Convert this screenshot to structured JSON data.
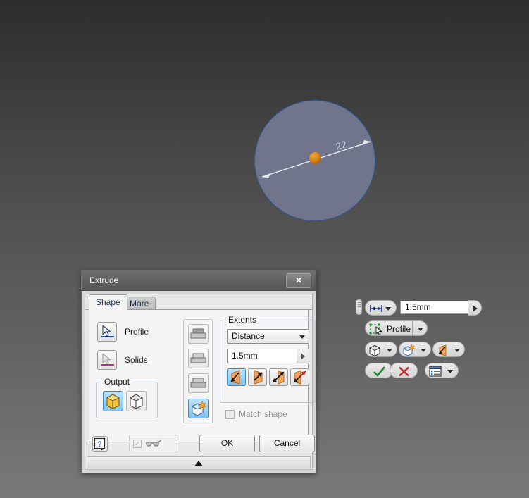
{
  "app": {
    "background_top": "#2d2d2e",
    "background_bottom": "#79797b"
  },
  "viewport": {
    "sketch": {
      "shape": "circle",
      "fill_color": "#70758c",
      "edge_color": "#2c5a96",
      "center_point_color": "#d9831c",
      "dimension_label": "22",
      "dimension_type": "diameter"
    }
  },
  "dialog": {
    "title": "Extrude",
    "close_label": "✕",
    "tabs": [
      {
        "label": "Shape",
        "active": true
      },
      {
        "label": "More",
        "active": false
      }
    ],
    "selectors": [
      {
        "label": "Profile",
        "icon": "arrow-cursor-icon",
        "underline_color": "#1b48c4",
        "active": true
      },
      {
        "label": "Solids",
        "icon": "arrow-cursor-icon",
        "underline_color": "#c42b86",
        "active": false
      }
    ],
    "output": {
      "caption": "Output",
      "options": [
        {
          "name": "solid",
          "icon": "solid-cube-icon",
          "selected": true
        },
        {
          "name": "surface",
          "icon": "surface-cube-icon",
          "selected": false
        }
      ]
    },
    "boolean_ops": [
      {
        "name": "join",
        "icon": "join-icon",
        "selected": false,
        "enabled": false
      },
      {
        "name": "cut",
        "icon": "cut-icon",
        "selected": false,
        "enabled": false
      },
      {
        "name": "intersect",
        "icon": "intersect-icon",
        "selected": false,
        "enabled": false
      },
      {
        "name": "new-solid",
        "icon": "new-solid-icon",
        "selected": true,
        "enabled": true
      }
    ],
    "extents": {
      "caption": "Extents",
      "type_value": "Distance",
      "distance_value": "1.5mm",
      "directions": [
        {
          "name": "direction-1",
          "selected": true
        },
        {
          "name": "direction-2",
          "selected": false
        },
        {
          "name": "symmetric",
          "selected": false
        },
        {
          "name": "asymmetric",
          "selected": false
        }
      ],
      "match_shape_label": "Match shape",
      "match_shape_checked": false,
      "match_shape_enabled": false
    },
    "footer": {
      "help_label": "?",
      "preview_checked": true,
      "preview_icon": "glasses-icon",
      "ok_label": "OK",
      "cancel_label": "Cancel"
    }
  },
  "mini_toolbar": {
    "distance_value": "1.5mm",
    "profile_label": "Profile",
    "row3": [
      {
        "name": "output-solid",
        "icon": "solid-cube-icon"
      },
      {
        "name": "new-solid",
        "icon": "new-solid-icon"
      },
      {
        "name": "direction",
        "icon": "direction-arrow-icon"
      }
    ],
    "ok_icon": "check-icon",
    "cancel_icon": "x-icon",
    "options_icon": "options-list-icon",
    "ok_color": "#1f8a2e",
    "cancel_color": "#c22424"
  }
}
